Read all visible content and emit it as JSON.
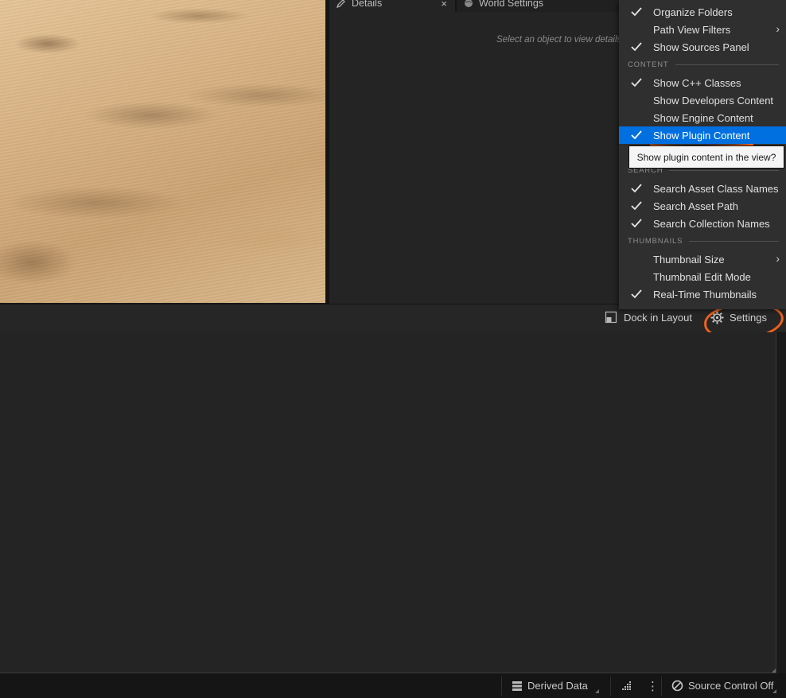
{
  "details_panel": {
    "tabs": [
      {
        "label": "Details"
      },
      {
        "label": "World Settings"
      }
    ],
    "close_glyph": "×",
    "hint": "Select an object to view details."
  },
  "toolbar": {
    "dock_label": "Dock in Layout",
    "settings_label": "Settings"
  },
  "settings_menu": {
    "items_top": [
      {
        "label": "Organize Folders",
        "checked": true
      },
      {
        "label": "Path View Filters",
        "checked": false,
        "submenu": true
      },
      {
        "label": "Show Sources Panel",
        "checked": true
      }
    ],
    "section_content": "CONTENT",
    "items_content": [
      {
        "label": "Show C++ Classes",
        "checked": true
      },
      {
        "label": "Show Developers Content",
        "checked": false
      },
      {
        "label": "Show Engine Content",
        "checked": false
      },
      {
        "label": "Show Plugin Content",
        "checked": true,
        "highlighted": true
      }
    ],
    "section_search": "SEARCH",
    "items_search": [
      {
        "label": "Search Asset Class Names",
        "checked": true
      },
      {
        "label": "Search Asset Path",
        "checked": true
      },
      {
        "label": "Search Collection Names",
        "checked": true
      }
    ],
    "section_thumbnails": "THUMBNAILS",
    "items_thumbnails": [
      {
        "label": "Thumbnail Size",
        "checked": false,
        "submenu": true
      },
      {
        "label": "Thumbnail Edit Mode",
        "checked": false
      },
      {
        "label": "Real-Time Thumbnails",
        "checked": true
      }
    ],
    "submenu_arrow": "›"
  },
  "tooltip": {
    "text": "Show plugin content in the view?"
  },
  "statusbar": {
    "derived_data_label": "Derived Data",
    "kebab_glyph": "⋮",
    "source_control_label": "Source Control Off"
  },
  "colors": {
    "highlight": "#0070e0",
    "annotation": "#f0621a",
    "menu_bg": "#2f2f2f",
    "panel_bg": "#242424"
  },
  "icons": [
    "pencil-icon",
    "globe-icon",
    "close-icon",
    "dock-layout-icon",
    "gear-icon",
    "checkmark-icon",
    "chevron-right-icon",
    "server-stack-icon",
    "activity-grid-icon",
    "kebab-icon",
    "no-entry-icon"
  ]
}
